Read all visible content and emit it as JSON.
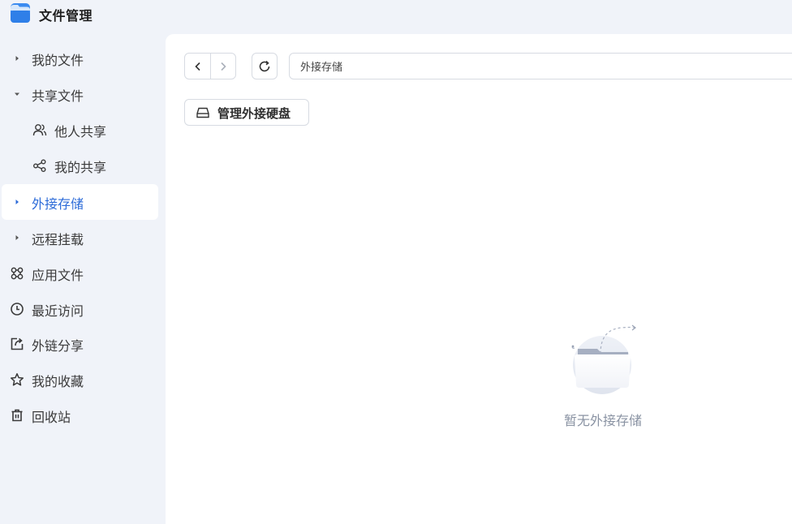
{
  "app": {
    "title": "文件管理"
  },
  "sidebar": {
    "items": [
      {
        "label": "我的文件",
        "icon": "caret-right-icon"
      },
      {
        "label": "共享文件",
        "icon": "caret-down-icon"
      },
      {
        "label": "他人共享",
        "icon": "users-icon"
      },
      {
        "label": "我的共享",
        "icon": "share-icon"
      },
      {
        "label": "外接存储",
        "icon": "caret-right-icon"
      },
      {
        "label": "远程挂载",
        "icon": "caret-right-icon"
      },
      {
        "label": "应用文件",
        "icon": "command-icon"
      },
      {
        "label": "最近访问",
        "icon": "clock-icon"
      },
      {
        "label": "外链分享",
        "icon": "external-share-icon"
      },
      {
        "label": "我的收藏",
        "icon": "star-icon"
      },
      {
        "label": "回收站",
        "icon": "trash-icon"
      }
    ],
    "active_label": "外接存储"
  },
  "toolbar": {
    "path": "外接存储"
  },
  "actions": {
    "manage_disks_label": "管理外接硬盘"
  },
  "empty_state": {
    "message": "暂无外接存储"
  },
  "colors": {
    "accent": "#2c6bd8",
    "sidebar_bg": "#f0f3f9",
    "main_bg": "#ffffff"
  }
}
